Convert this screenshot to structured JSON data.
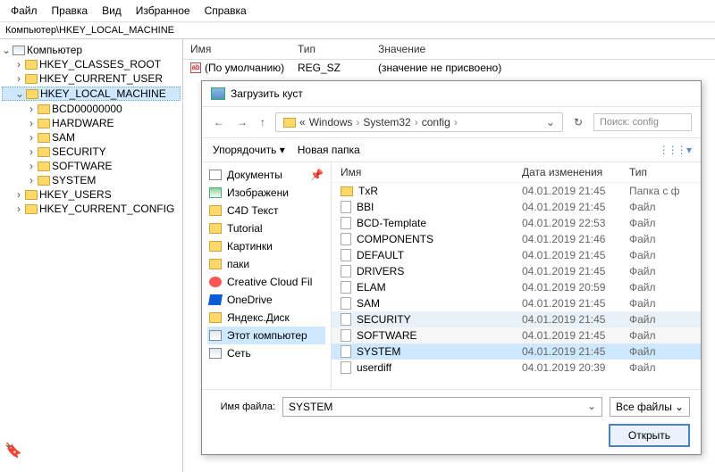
{
  "menu": {
    "items": [
      "Файл",
      "Правка",
      "Вид",
      "Избранное",
      "Справка"
    ]
  },
  "address_bar": "Компьютер\\HKEY_LOCAL_MACHINE",
  "tree": {
    "root": "Компьютер",
    "hives": [
      {
        "name": "HKEY_CLASSES_ROOT",
        "expanded": false,
        "selected": false,
        "children": []
      },
      {
        "name": "HKEY_CURRENT_USER",
        "expanded": false,
        "selected": false,
        "children": []
      },
      {
        "name": "HKEY_LOCAL_MACHINE",
        "expanded": true,
        "selected": true,
        "children": [
          "BCD00000000",
          "HARDWARE",
          "SAM",
          "SECURITY",
          "SOFTWARE",
          "SYSTEM"
        ]
      },
      {
        "name": "HKEY_USERS",
        "expanded": false,
        "selected": false,
        "children": []
      },
      {
        "name": "HKEY_CURRENT_CONFIG",
        "expanded": false,
        "selected": false,
        "children": []
      }
    ]
  },
  "values_list": {
    "headers": {
      "name": "Имя",
      "type": "Тип",
      "data": "Значение"
    },
    "rows": [
      {
        "name": "(По умолчанию)",
        "type": "REG_SZ",
        "data": "(значение не присвоено)"
      }
    ]
  },
  "dialog": {
    "title": "Загрузить куст",
    "nav": {
      "back": "←",
      "forward": "→",
      "up": "↑",
      "path_prefix": "«",
      "crumbs": [
        "Windows",
        "System32",
        "config"
      ],
      "crumb_sep": "›",
      "refresh": "↻",
      "search_placeholder": "Поиск: config"
    },
    "toolbar": {
      "organize": "Упорядочить ▾",
      "new_folder": "Новая папка",
      "view_icon": "⋮⋮⋮ ▾"
    },
    "sidebar": [
      {
        "label": "Документы",
        "pin": "📌",
        "icon": "docs",
        "selected": false
      },
      {
        "label": "Изображени",
        "icon": "img",
        "selected": false
      },
      {
        "label": "C4D Текст",
        "icon": "fold",
        "selected": false
      },
      {
        "label": "Tutorial",
        "icon": "fold",
        "selected": false
      },
      {
        "label": "Картинки",
        "icon": "fold",
        "selected": false
      },
      {
        "label": "паки",
        "icon": "fold",
        "selected": false
      },
      {
        "label": "Creative Cloud Fil",
        "icon": "cc",
        "selected": false
      },
      {
        "label": "OneDrive",
        "icon": "od",
        "selected": false
      },
      {
        "label": "Яндекс.Диск",
        "icon": "fold",
        "selected": false
      },
      {
        "label": "Этот компьютер",
        "icon": "pc",
        "selected": true
      },
      {
        "label": "Сеть",
        "icon": "net",
        "selected": false
      }
    ],
    "file_headers": {
      "name": "Имя",
      "date": "Дата изменения",
      "type": "Тип"
    },
    "files": [
      {
        "name": "TxR",
        "date": "04.01.2019 21:45",
        "type": "Папка с ф",
        "kind": "folder",
        "sel": ""
      },
      {
        "name": "BBI",
        "date": "04.01.2019 21:45",
        "type": "Файл",
        "kind": "file",
        "sel": ""
      },
      {
        "name": "BCD-Template",
        "date": "04.01.2019 22:53",
        "type": "Файл",
        "kind": "file",
        "sel": ""
      },
      {
        "name": "COMPONENTS",
        "date": "04.01.2019 21:46",
        "type": "Файл",
        "kind": "file",
        "sel": ""
      },
      {
        "name": "DEFAULT",
        "date": "04.01.2019 21:45",
        "type": "Файл",
        "kind": "file",
        "sel": ""
      },
      {
        "name": "DRIVERS",
        "date": "04.01.2019 21:45",
        "type": "Файл",
        "kind": "file",
        "sel": ""
      },
      {
        "name": "ELAM",
        "date": "04.01.2019 20:59",
        "type": "Файл",
        "kind": "file",
        "sel": ""
      },
      {
        "name": "SAM",
        "date": "04.01.2019 21:45",
        "type": "Файл",
        "kind": "file",
        "sel": ""
      },
      {
        "name": "SECURITY",
        "date": "04.01.2019 21:45",
        "type": "Файл",
        "kind": "file",
        "sel": "highlight"
      },
      {
        "name": "SOFTWARE",
        "date": "04.01.2019 21:45",
        "type": "Файл",
        "kind": "file",
        "sel": "striped"
      },
      {
        "name": "SYSTEM",
        "date": "04.01.2019 21:45",
        "type": "Файл",
        "kind": "file",
        "sel": "selected"
      },
      {
        "name": "userdiff",
        "date": "04.01.2019 20:39",
        "type": "Файл",
        "kind": "file",
        "sel": ""
      }
    ],
    "footer": {
      "filename_label": "Имя файла:",
      "filename_value": "SYSTEM",
      "filter": "Все файлы",
      "filter_arrow": "⌄",
      "open": "Открыть"
    }
  }
}
